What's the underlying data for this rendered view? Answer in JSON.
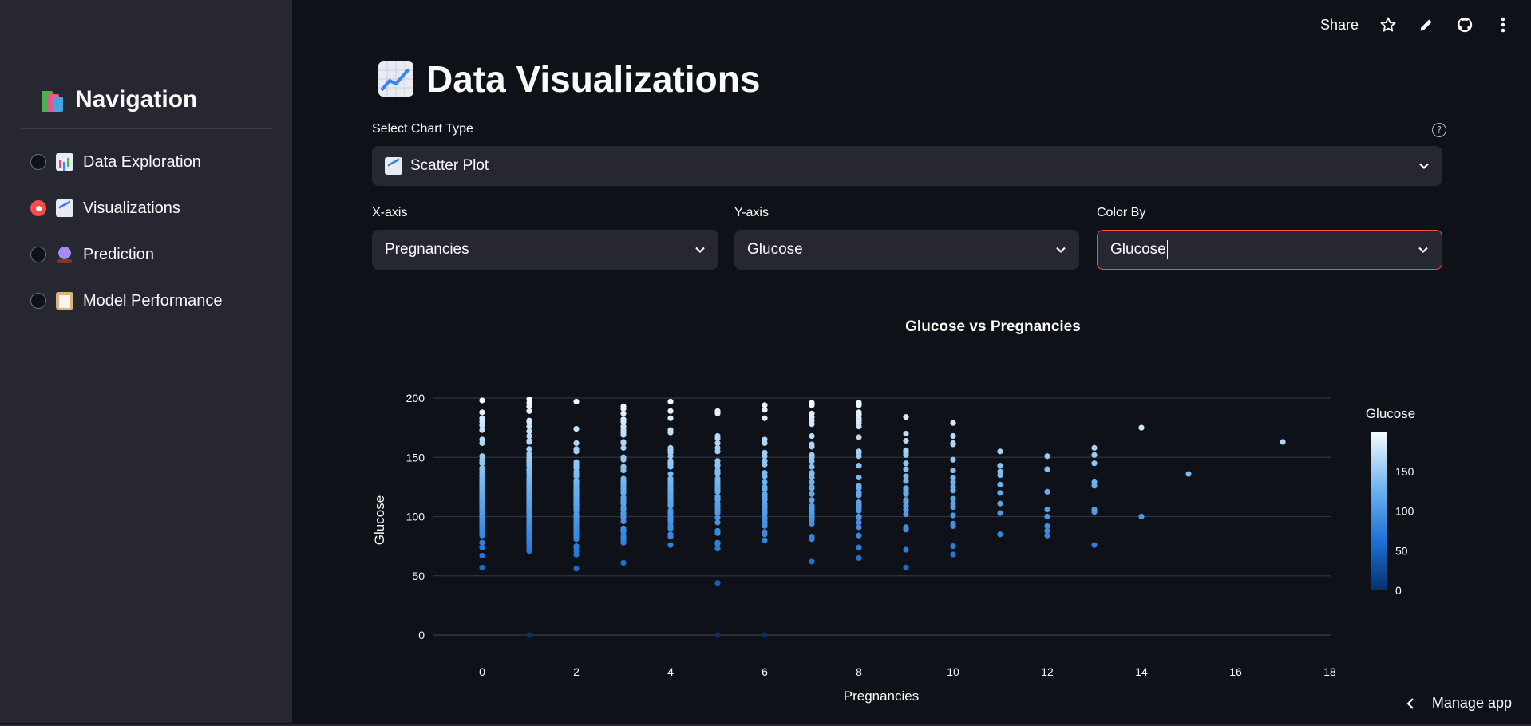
{
  "sidebar": {
    "title": "Navigation",
    "title_icon": "books-icon",
    "items": [
      {
        "label": "Data Exploration",
        "icon": "bar-chart-icon",
        "selected": false
      },
      {
        "label": "Visualizations",
        "icon": "line-chart-icon",
        "selected": true
      },
      {
        "label": "Prediction",
        "icon": "crystal-ball-icon",
        "selected": false
      },
      {
        "label": "Model Performance",
        "icon": "clipboard-icon",
        "selected": false
      }
    ]
  },
  "toolbar": {
    "share_label": "Share",
    "icons": [
      "star-icon",
      "edit-icon",
      "github-icon",
      "more-vertical-icon"
    ]
  },
  "main": {
    "title": "Data Visualizations",
    "chart_type": {
      "label": "Select Chart Type",
      "value": "Scatter Plot"
    },
    "x_axis": {
      "label": "X-axis",
      "value": "Pregnancies"
    },
    "y_axis": {
      "label": "Y-axis",
      "value": "Glucose"
    },
    "color_by": {
      "label": "Color By",
      "value": "Glucose"
    }
  },
  "colors": {
    "accent": "#ff4b4b",
    "background": "#0e1117",
    "sidebar": "#262730",
    "scale_low": "#08306b",
    "scale_high": "#f7fbff"
  },
  "chart_data": {
    "type": "scatter",
    "title": "Glucose vs Pregnancies",
    "xlabel": "Pregnancies",
    "ylabel": "Glucose",
    "xlim": [
      -1,
      18
    ],
    "ylim": [
      0,
      200
    ],
    "xticks": [
      0,
      2,
      4,
      6,
      8,
      10,
      12,
      14,
      16,
      18
    ],
    "yticks": [
      0,
      50,
      100,
      150,
      200
    ],
    "grid": true,
    "colorbar": {
      "title": "Glucose",
      "ticks": [
        0,
        50,
        100,
        150
      ],
      "range": [
        0,
        199
      ]
    },
    "series": [
      {
        "x": 0,
        "y": [
          57,
          67,
          74,
          78,
          84,
          86,
          88,
          90,
          92,
          93,
          95,
          96,
          97,
          99,
          100,
          101,
          102,
          104,
          105,
          106,
          107,
          108,
          109,
          110,
          111,
          112,
          113,
          114,
          115,
          116,
          117,
          118,
          119,
          120,
          121,
          122,
          123,
          124,
          125,
          126,
          127,
          128,
          129,
          130,
          131,
          132,
          134,
          135,
          137,
          138,
          140,
          141,
          145,
          146,
          148,
          151,
          162,
          165,
          173,
          177,
          180,
          183,
          188,
          198
        ]
      },
      {
        "x": 1,
        "y": [
          0,
          71,
          73,
          75,
          77,
          78,
          79,
          80,
          81,
          83,
          84,
          85,
          86,
          87,
          88,
          89,
          90,
          91,
          92,
          93,
          94,
          95,
          96,
          97,
          98,
          99,
          100,
          101,
          102,
          103,
          104,
          105,
          106,
          107,
          108,
          109,
          110,
          111,
          112,
          113,
          114,
          115,
          116,
          117,
          118,
          119,
          120,
          121,
          122,
          123,
          124,
          125,
          126,
          127,
          128,
          129,
          130,
          131,
          132,
          133,
          135,
          137,
          139,
          140,
          143,
          144,
          146,
          147,
          149,
          151,
          153,
          157,
          163,
          164,
          168,
          172,
          176,
          180,
          181,
          189,
          193,
          196,
          199
        ]
      },
      {
        "x": 2,
        "y": [
          56,
          68,
          71,
          74,
          75,
          81,
          83,
          84,
          85,
          87,
          88,
          90,
          92,
          94,
          95,
          96,
          98,
          99,
          100,
          101,
          102,
          105,
          106,
          107,
          108,
          109,
          110,
          111,
          112,
          114,
          115,
          117,
          118,
          119,
          120,
          121,
          122,
          123,
          125,
          127,
          128,
          129,
          130,
          134,
          136,
          138,
          141,
          142,
          144,
          146,
          155,
          157,
          162,
          174,
          197
        ]
      },
      {
        "x": 3,
        "y": [
          61,
          78,
          80,
          81,
          83,
          84,
          87,
          88,
          89,
          90,
          96,
          99,
          100,
          102,
          103,
          106,
          107,
          108,
          111,
          112,
          113,
          115,
          116,
          120,
          122,
          123,
          124,
          126,
          128,
          129,
          130,
          132,
          139,
          141,
          142,
          148,
          150,
          158,
          162,
          163,
          169,
          171,
          173,
          176,
          180,
          182,
          187,
          191,
          193
        ]
      },
      {
        "x": 4,
        "y": [
          76,
          83,
          85,
          90,
          91,
          92,
          95,
          97,
          99,
          100,
          103,
          105,
          109,
          110,
          111,
          112,
          114,
          116,
          117,
          118,
          120,
          122,
          123,
          125,
          127,
          129,
          131,
          132,
          136,
          142,
          144,
          145,
          146,
          147,
          151,
          154,
          156,
          158,
          171,
          173,
          183,
          189,
          197
        ]
      },
      {
        "x": 5,
        "y": [
          44,
          0,
          73,
          77,
          78,
          86,
          88,
          95,
          99,
          103,
          105,
          106,
          108,
          109,
          111,
          114,
          115,
          116,
          117,
          121,
          123,
          124,
          126,
          128,
          130,
          132,
          136,
          137,
          139,
          143,
          144,
          147,
          155,
          158,
          162,
          166,
          168,
          187,
          189
        ]
      },
      {
        "x": 6,
        "y": [
          0,
          80,
          85,
          87,
          92,
          93,
          94,
          96,
          98,
          99,
          102,
          103,
          104,
          105,
          107,
          108,
          109,
          111,
          114,
          115,
          117,
          119,
          123,
          124,
          125,
          129,
          134,
          137,
          144,
          147,
          151,
          154,
          162,
          165,
          183,
          190,
          194
        ]
      },
      {
        "x": 7,
        "y": [
          62,
          81,
          83,
          94,
          97,
          99,
          100,
          102,
          103,
          105,
          106,
          107,
          109,
          114,
          119,
          124,
          125,
          129,
          133,
          136,
          137,
          142,
          147,
          150,
          152,
          159,
          161,
          168,
          178,
          181,
          184,
          187,
          194,
          195,
          196
        ]
      },
      {
        "x": 8,
        "y": [
          65,
          74,
          84,
          91,
          95,
          99,
          100,
          105,
          107,
          108,
          110,
          112,
          118,
          120,
          124,
          126,
          133,
          143,
          151,
          154,
          155,
          167,
          176,
          179,
          181,
          183,
          186,
          188,
          194,
          196
        ]
      },
      {
        "x": 9,
        "y": [
          57,
          72,
          89,
          91,
          102,
          106,
          109,
          112,
          114,
          119,
          120,
          123,
          124,
          130,
          134,
          140,
          145,
          152,
          154,
          156,
          164,
          170,
          184
        ]
      },
      {
        "x": 10,
        "y": [
          68,
          75,
          92,
          94,
          101,
          108,
          111,
          115,
          122,
          125,
          129,
          133,
          139,
          148,
          161,
          162,
          168,
          179
        ]
      },
      {
        "x": 11,
        "y": [
          85,
          103,
          111,
          120,
          127,
          135,
          138,
          143,
          155
        ]
      },
      {
        "x": 12,
        "y": [
          84,
          88,
          92,
          100,
          106,
          121,
          140,
          151
        ]
      },
      {
        "x": 13,
        "y": [
          76,
          104,
          106,
          126,
          129,
          145,
          152,
          158
        ]
      },
      {
        "x": 14,
        "y": [
          100,
          175
        ]
      },
      {
        "x": 15,
        "y": [
          136
        ]
      },
      {
        "x": 17,
        "y": [
          163
        ]
      }
    ]
  }
}
